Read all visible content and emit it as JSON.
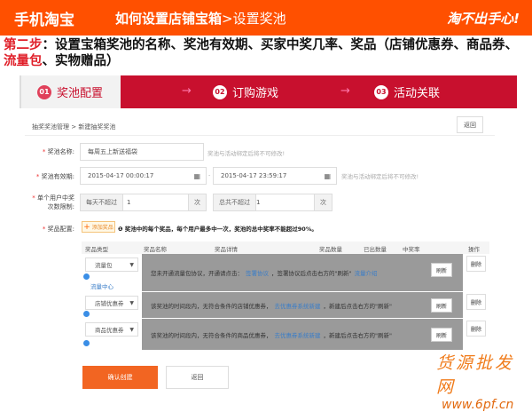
{
  "header": {
    "brand": "手机淘宝",
    "title": "如何设置店铺宝箱",
    "title_sep": ">",
    "subtitle": "设置奖池",
    "slogan": "淘不出手心!"
  },
  "instruction": {
    "step": "第二步",
    "text1": "：设置宝箱奖池的名称、奖池有效期、买家中奖几率、奖品（店铺优惠券、商品券、",
    "highlight": "流量包",
    "text2": "、实物赠品）"
  },
  "steps": [
    {
      "num": "01",
      "label": "奖池配置"
    },
    {
      "num": "02",
      "label": "订购游戏"
    },
    {
      "num": "03",
      "label": "活动关联"
    }
  ],
  "arrow": "→",
  "breadcrumb": "抽奖奖池管理 > 新建抽奖奖池",
  "back_top": "返回",
  "form": {
    "name_label": "奖池名称:",
    "name_value": "每周五上新送福袋",
    "name_hint": "奖池与活动绑定后将不可修改!",
    "period_label": "奖池有效期:",
    "start": "2015-04-17 00:00:17",
    "dash": "-",
    "end": "2015-04-17 23:59:17",
    "period_hint": "奖池与活动绑定后将不可修改!",
    "limit_label1": "单个用户中奖",
    "limit_label2": "次数限制:",
    "daily_prefix": "每天不超过",
    "daily_value": "1",
    "unit": "次",
    "total_prefix": "总共不超过",
    "total_value": "1",
    "prize_label": "奖品配置:",
    "add_prize": "添加奖品",
    "prize_note": "奖池中的每个奖品，每个用户最多中一次，奖池的总中奖率不能超过90%。"
  },
  "table": {
    "headers": [
      "奖品类型",
      "奖品名称",
      "奖品详情",
      "奖品数量",
      "已出数量",
      "中奖率",
      "操作"
    ],
    "rows": [
      {
        "type": "流量包",
        "extra": "流量中心",
        "text": "您未开通流量包协议，开通请点击：",
        "link": "签署协议",
        "text2": "，签署协议后点击右方的\"刷新\"",
        "link2": "流量介绍",
        "refresh": "刷新",
        "del": "删除"
      },
      {
        "type": "店铺优惠券",
        "text": "该奖池的时间段内，无符合条件的店铺优惠券，",
        "link": "去优惠券系统新建",
        "text2": "，新建后点击右方的\"刷新\"",
        "refresh": "刷新",
        "del": "删除"
      },
      {
        "type": "商品优惠券",
        "text": "该奖池的时间段内，无符合条件的商品优惠券，",
        "link": "去优惠券系统新建",
        "text2": "，新建后点击右方的\"刷新\"",
        "refresh": "刷新",
        "del": "删除"
      }
    ]
  },
  "confirm": "确认创建",
  "back": "返回",
  "watermark": {
    "line1": "货源批发网",
    "line2": "www.6pf.cn"
  }
}
